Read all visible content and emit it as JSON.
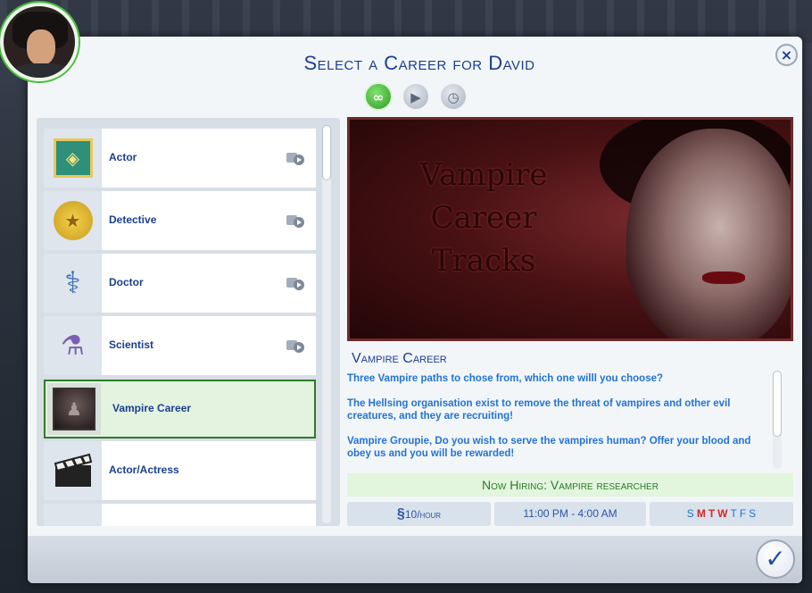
{
  "window": {
    "title": "Select a Career for David",
    "close_label": "×"
  },
  "filters": [
    {
      "icon": "infinity-icon",
      "glyph": "∞",
      "active": true
    },
    {
      "icon": "camera-play-icon",
      "glyph": "▶",
      "active": false
    },
    {
      "icon": "camera-clock-icon",
      "glyph": "◷",
      "active": false
    }
  ],
  "careers": [
    {
      "label": "Actor",
      "icon": "actor-icon",
      "glyph": "◈",
      "tone_icon": "camera-play-icon"
    },
    {
      "label": "Detective",
      "icon": "badge-icon",
      "glyph": "★",
      "tone_icon": "camera-play-icon"
    },
    {
      "label": "Doctor",
      "icon": "caduceus-icon",
      "glyph": "⚕",
      "tone_icon": "camera-play-icon"
    },
    {
      "label": "Scientist",
      "icon": "flask-icon",
      "glyph": "⚗",
      "tone_icon": "camera-play-icon"
    },
    {
      "label": "Vampire Career",
      "icon": "vampire-portrait-icon",
      "glyph": "♟",
      "selected": true
    },
    {
      "label": "Actor/Actress",
      "icon": "clapperboard-icon",
      "glyph": "🎬"
    }
  ],
  "banner": {
    "text_lines": [
      "Vampire",
      "Career",
      "Tracks"
    ]
  },
  "detail": {
    "heading": "Vampire Career",
    "paragraphs": [
      "Three Vampire paths to chose from, which one willl you choose?",
      "The Hellsing organisation exist to remove the threat of vampires and other evil creatures, and they are recruiting!",
      "Vampire Groupie, Do you wish to serve the vampires human? Offer your blood and obey us and you will be rewarded!"
    ],
    "hiring": "Now Hiring:  Vampire researcher",
    "wage_symbol": "§",
    "wage_amount": "10",
    "wage_unit": "/hour",
    "hours": "11:00 PM - 4:00 AM",
    "days": [
      {
        "letter": "S",
        "work": false
      },
      {
        "letter": "M",
        "work": true
      },
      {
        "letter": "T",
        "work": true
      },
      {
        "letter": "W",
        "work": true
      },
      {
        "letter": "T",
        "work": false
      },
      {
        "letter": "F",
        "work": false
      },
      {
        "letter": "S",
        "work": false
      }
    ]
  },
  "confirm_label": "✓",
  "colors": {
    "accent_blue": "#1a3f8f",
    "text_blue": "#2273d6",
    "green": "#2d7a2a",
    "work_day_red": "#d32929"
  }
}
